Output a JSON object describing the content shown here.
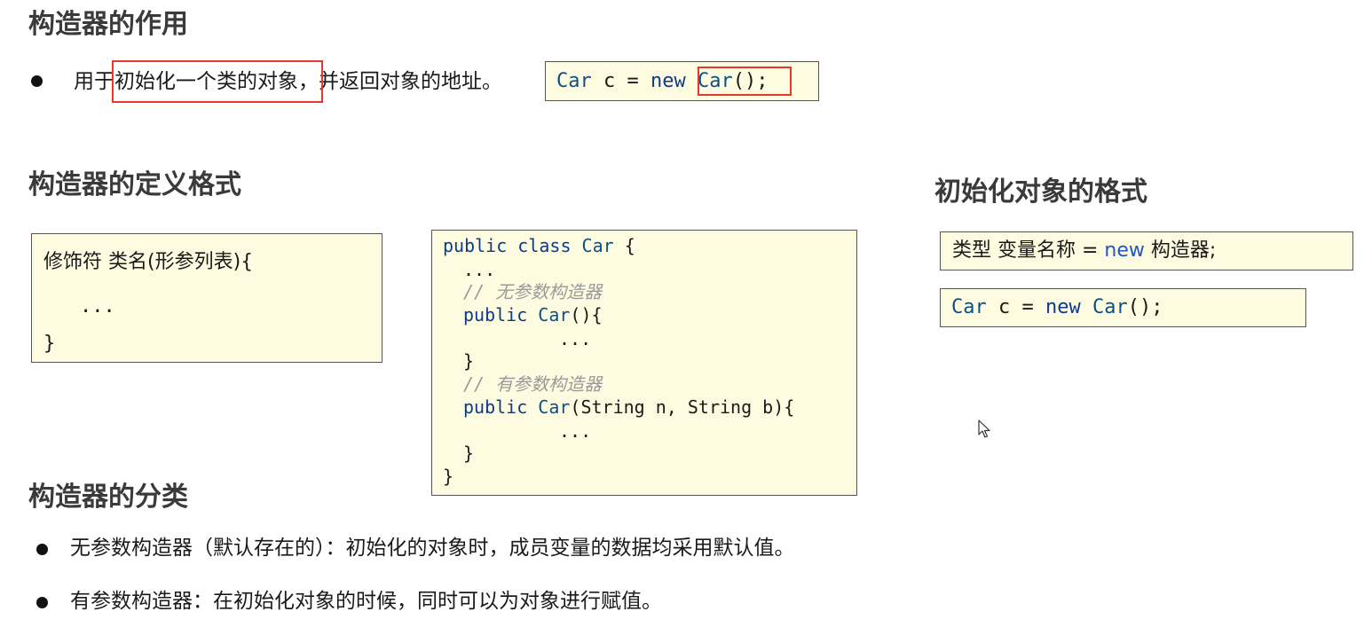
{
  "section1": {
    "title": "构造器的作用",
    "bullet": {
      "prefix": "用于",
      "highlight": "初始化一个类的对象",
      "suffix": "，并返回对象的地址。"
    },
    "code": {
      "type_name": "Car",
      "var": " c = ",
      "kw_new": "new",
      "space": " ",
      "ctor": "Car",
      "tail": "();"
    }
  },
  "section2": {
    "title": "构造器的定义格式",
    "format_box": {
      "line1": "修饰符 类名(形参列表){",
      "line2": "...",
      "line3": "}"
    },
    "code_box": {
      "line1_kw": "public class",
      "line1_cls": "Car",
      "line1_tail": " {",
      "line2": "...",
      "comment1": "// 无参数构造器",
      "line4_kw": "public",
      "line4_cls": "Car",
      "line4_tail": "(){",
      "line5": "...",
      "line6": "}",
      "comment2": "// 有参数构造器",
      "line8_kw": "public",
      "line8_cls": "Car",
      "line8_tail": "(String n, String b){",
      "line9": "...",
      "line10": "}",
      "line11": "}"
    }
  },
  "section3": {
    "title": "初始化对象的格式",
    "format_line": {
      "pre": "类型 变量名称 = ",
      "kw": "new",
      "post": " 构造器;"
    },
    "example": {
      "type_name": "Car",
      "var": " c = ",
      "kw_new": "new",
      "ctor": " Car",
      "tail": "();"
    }
  },
  "section4": {
    "title": "构造器的分类",
    "bullets": [
      "无参数构造器（默认存在的）：初始化的对象时，成员变量的数据均采用默认值。",
      "有参数构造器：在初始化对象的时候，同时可以为对象进行赋值。"
    ]
  },
  "colors": {
    "note_bg": "#fdfbe0",
    "keyword_blue": "#0d3b8c",
    "highlight_red": "#e53a2b",
    "comment_gray": "#9a9a9a"
  },
  "icons": {
    "cursor": "mouse-pointer-icon",
    "bullet": "bullet-dot-icon"
  }
}
